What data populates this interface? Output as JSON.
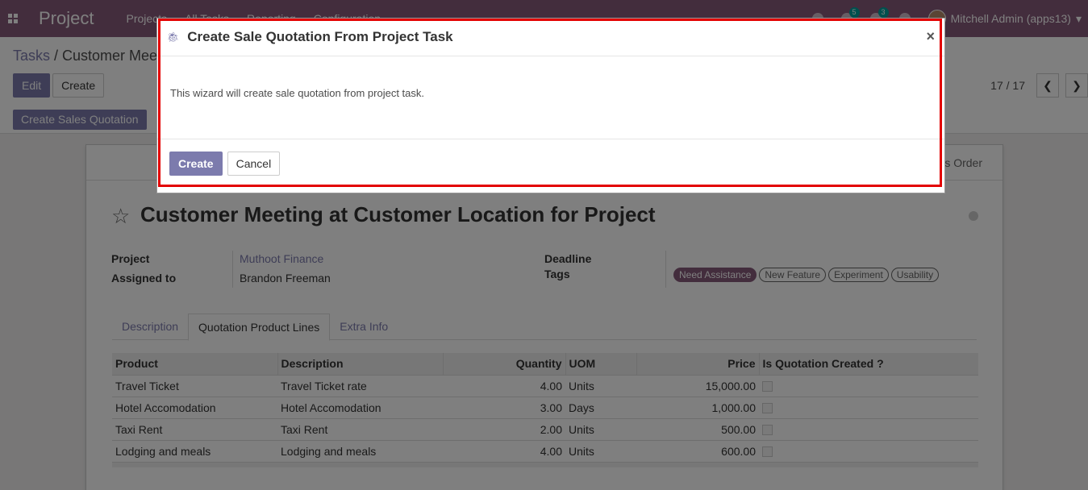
{
  "navbar": {
    "brand": "Project",
    "menu": [
      "Projects",
      "All Tasks",
      "Reporting",
      "Configuration"
    ],
    "activity_badge": "5",
    "message_badge": "3",
    "user": "Mitchell Admin (apps13)",
    "color": "#875a7b"
  },
  "breadcrumb": {
    "parent": "Tasks",
    "separator": " / ",
    "current": "Customer Meeting at Customer Location for Project"
  },
  "control": {
    "edit_label": "Edit",
    "create_label": "Create",
    "pager": "17 / 17",
    "create_quotation_label": "Create Sales Quotation"
  },
  "form": {
    "smart_button": "Sales Order",
    "title": "Customer Meeting at Customer Location for Project",
    "project_label": "Project",
    "project_value": "Muthoot Finance",
    "assigned_label": "Assigned to",
    "assigned_value": "Brandon Freeman",
    "deadline_label": "Deadline",
    "tags_label": "Tags",
    "tags": [
      "Need Assistance",
      "New Feature",
      "Experiment",
      "Usability"
    ],
    "tabs": [
      "Description",
      "Quotation Product Lines",
      "Extra Info"
    ],
    "columns": [
      "Product",
      "Description",
      "Quantity",
      "UOM",
      "Price",
      "Is Quotation Created ?"
    ],
    "rows": [
      {
        "product": "Travel Ticket",
        "description": "Travel Ticket rate",
        "quantity": "4.00",
        "uom": "Units",
        "price": "15,000.00"
      },
      {
        "product": "Hotel Accomodation",
        "description": "Hotel Accomodation",
        "quantity": "3.00",
        "uom": "Days",
        "price": "1,000.00"
      },
      {
        "product": "Taxi Rent",
        "description": "Taxi Rent",
        "quantity": "2.00",
        "uom": "Units",
        "price": "500.00"
      },
      {
        "product": "Lodging and meals",
        "description": "Lodging and meals",
        "quantity": "4.00",
        "uom": "Units",
        "price": "600.00"
      }
    ]
  },
  "modal": {
    "title": "Create Sale Quotation From Project Task",
    "body": "This wizard will create sale quotation from project task.",
    "create_label": "Create",
    "cancel_label": "Cancel",
    "highlight_color": "#e30000"
  }
}
